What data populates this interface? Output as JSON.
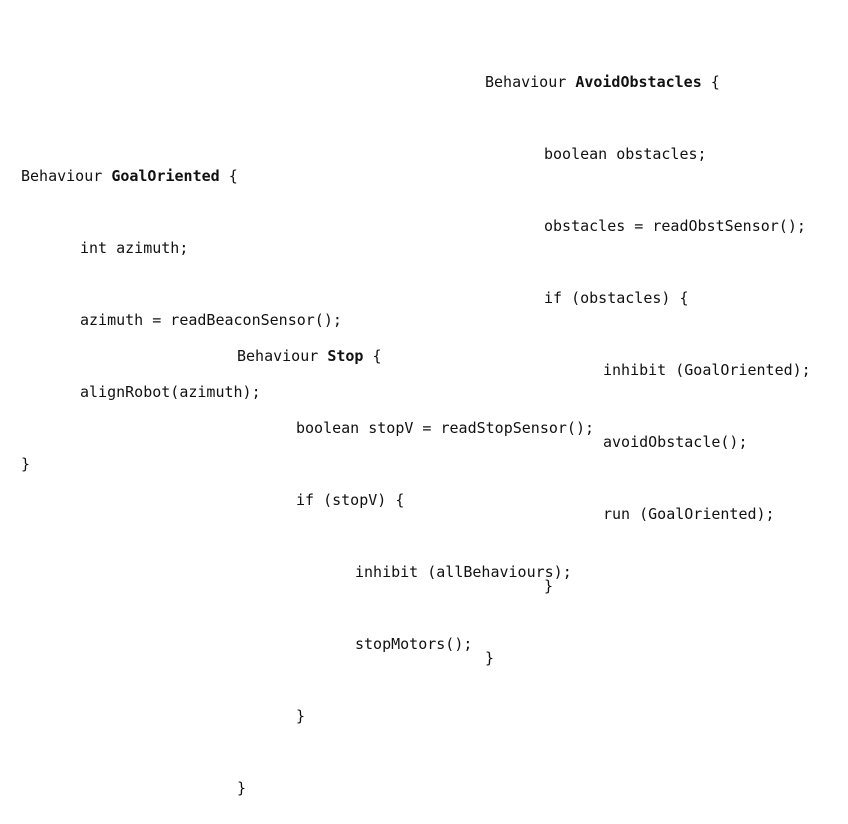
{
  "goal_oriented": {
    "keyword": "Behaviour",
    "name": "GoalOriented",
    "open_brace": "{",
    "lines": [
      "int azimuth;",
      "azimuth = readBeaconSensor();",
      "alignRobot(azimuth);"
    ],
    "close_brace": "}"
  },
  "avoid_obstacles": {
    "keyword": "Behaviour",
    "name": "AvoidObstacles",
    "open_brace": "{",
    "lines": [
      "boolean obstacles;",
      "obstacles = readObstSensor();",
      "if (obstacles) {"
    ],
    "inner_lines": [
      "inhibit (GoalOriented);",
      "avoidObstacle();",
      "run (GoalOriented);"
    ],
    "inner_close": "}",
    "close_brace": "}"
  },
  "stop": {
    "keyword": "Behaviour",
    "name": "Stop",
    "open_brace": "{",
    "lines": [
      "boolean stopV = readStopSensor();",
      "if (stopV) {"
    ],
    "inner_lines": [
      "inhibit (allBehaviours);",
      "stopMotors();"
    ],
    "inner_close": "}",
    "close_brace": "}"
  }
}
